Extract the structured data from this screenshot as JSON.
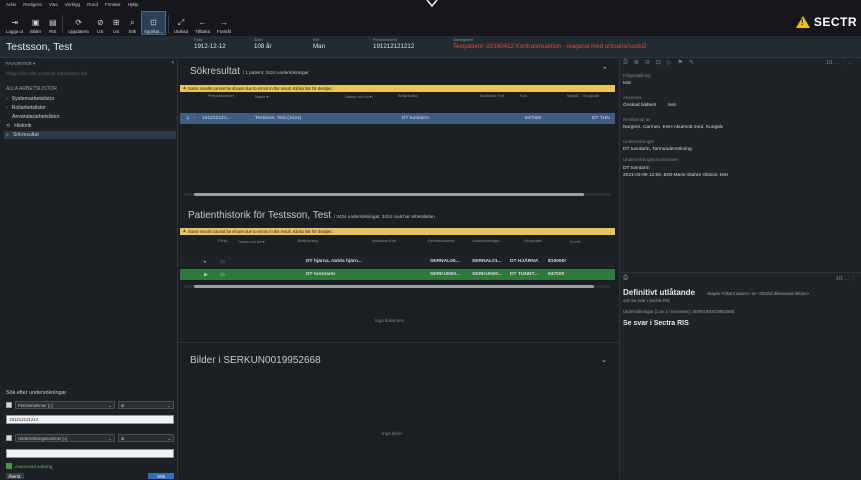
{
  "menu": [
    "Arkiv",
    "Redigera",
    "Visa",
    "Verktyg",
    "Rond",
    "Fönster",
    "Hjälp"
  ],
  "toolbar": [
    {
      "label": "Logga ut",
      "icon": "logout-icon",
      "glyph": "⇥"
    },
    {
      "label": "Bilder",
      "icon": "images-icon",
      "glyph": "▣"
    },
    {
      "label": "RIS",
      "icon": "ris-icon",
      "glyph": "▤"
    },
    {
      "label": "Uppdatera",
      "icon": "refresh-icon",
      "glyph": "⟳"
    },
    {
      "label": "US",
      "icon": "us-icon",
      "glyph": "⊘"
    },
    {
      "label": "US",
      "icon": "us-icon-2",
      "glyph": "⊞"
    },
    {
      "label": "Sök",
      "icon": "search-icon",
      "glyph": "⌕"
    },
    {
      "label": "Applikat...",
      "icon": "application-icon",
      "glyph": "⊡"
    },
    {
      "label": "Utökad",
      "icon": "extended-icon",
      "glyph": "⤢"
    },
    {
      "label": "Tillbaka",
      "icon": "back-icon",
      "glyph": "←"
    },
    {
      "label": "Framåt",
      "icon": "forward-icon",
      "glyph": "→"
    }
  ],
  "logo": "SECTR",
  "patient": {
    "name": "Testsson, Test",
    "fields": [
      {
        "label": "Född",
        "value": "1912-12-12"
      },
      {
        "label": "Ålder",
        "value": "108 år"
      },
      {
        "label": "Kön",
        "value": "Man"
      },
      {
        "label": "Personnummer",
        "value": "191212121212"
      },
      {
        "label": "Varningstext",
        "value": "Testpatient~20160412 Kontrastreaktion - reagerat med urticaria/susbi2"
      }
    ]
  },
  "left": {
    "favorites": "FAVORITER ▾",
    "favorites_hint": "Släpp dina ofta använda arbetslistor här",
    "all_lists": "ALLA ARBETSLISTOR",
    "items": [
      {
        "label": "Systemarbetslistor",
        "prefix": "›"
      },
      {
        "label": "Rollarbetslistor",
        "prefix": "›"
      },
      {
        "label": "Användararbetslistor",
        "prefix": ""
      },
      {
        "label": "Historik",
        "prefix": "⟲"
      },
      {
        "label": "Sökresultat",
        "prefix": "⌕"
      }
    ],
    "search_title": "Sök efter undersökningar",
    "search1": {
      "field": "Personnummer [=]",
      "op": "är",
      "value": "191212121212"
    },
    "search2": {
      "field": "Undersökningsnummer [=]",
      "op": "är",
      "value": ""
    },
    "advanced": "Avancerad sökning",
    "reset": "Återst.",
    "search_btn": "Sök"
  },
  "results": {
    "title": "Sökresultat",
    "subtitle": "1 patient, 3424 undersökningar",
    "warning": "Some results cannot be shown due to errors in the result. Klicka här för detaljer...",
    "columns": [
      "Personnummer",
      "Namn ▾↑",
      "Datum och tid ▾↓",
      "Beskrivning",
      "Institution Kort",
      "Kod",
      "Modali... Gruppnde"
    ],
    "row": {
      "pnr": "191212121...",
      "name": "Testsson, Test (3424)",
      "desc": "DT tunntarm",
      "code": "847000",
      "mod": "DT TUN"
    }
  },
  "history": {
    "title": "Patienthistorik för Testsson, Test",
    "subtitle": "3424 undersökningar, 3424 matchar arbetslistan",
    "warning": "Some results cannot be shown due to errors in the result. Klicka här för detaljer...",
    "columns": [
      "Förtp...",
      "Datum och tid ▾↑",
      "Beskrivning",
      "Institution Kort",
      "Remissnummer",
      "Undersökningsn...",
      "Gruppnde!",
      "Kod ▾↑"
    ],
    "rows": [
      {
        "desc": "DT hjärna, räddа hjärn...",
        "rem": "SERNAL00...",
        "us": "SERNAL01...",
        "grp": "DT HJÄRNA",
        "kod": "810000r"
      },
      {
        "desc": "DT tunntarm",
        "rem": "SERKUN00...",
        "us": "SERKUN00...",
        "grp": "DT TUNNT...",
        "kod": "847000"
      }
    ],
    "empty": "Inga dokument"
  },
  "images": {
    "title": "Bilder i SERKUN0019952668",
    "empty": "Inga bilder"
  },
  "right": {
    "pager_top": "1/1",
    "fields": [
      {
        "label": "Frågeställning",
        "value": "test"
      },
      {
        "label": "Anamnes",
        "value": "Önskad bildtest         test"
      },
      {
        "label": "Remitterad av",
        "value": "Norgren, Carmen, KSH Akutmott med, Kungälv"
      },
      {
        "label": "Undersökningar",
        "value": "DT tunntarm, Tarmundersökning"
      },
      {
        "label": "Undersökningskommentarer",
        "value": "DT tunntarm"
      },
      {
        "label": "",
        "value": "2021-03-09 12:56, Britt-Marie Stahre Olsson: test"
      }
    ],
    "pager_bottom": "1/1",
    "report_title": "Definitivt utlåtande",
    "report_meta": "skapat <Okänt datum> av <Okänd dikterande läkare>",
    "report_sub": "och Se svar i Sectra RIS",
    "report_exam": "Undersökningar (1 av 2 i remissen): SERKUN0019952668",
    "report_body": "Se svar i Sectra RIS"
  }
}
